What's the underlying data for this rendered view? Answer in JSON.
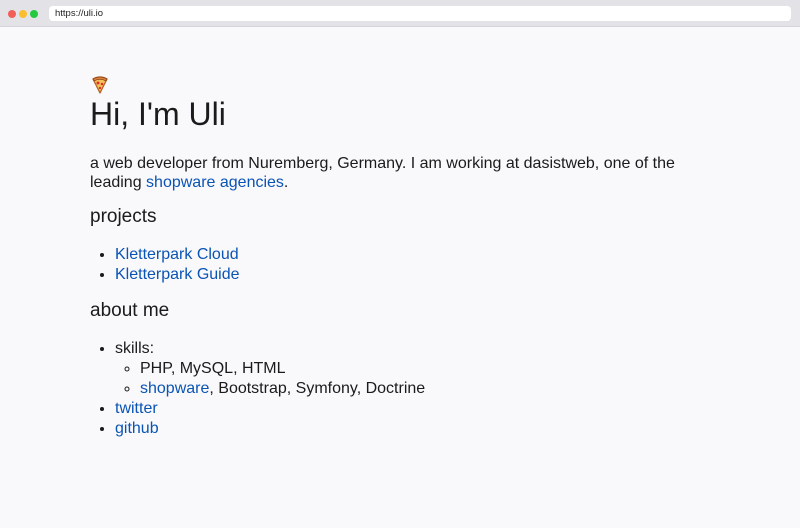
{
  "browser": {
    "url": "https://uli.io",
    "colors": {
      "close": "#f25f58",
      "minimize": "#fbbe2e",
      "maximize": "#25c93f"
    }
  },
  "page": {
    "emoji_icon": "pizza-icon",
    "title": "Hi, I'm Uli",
    "intro_text": "a web developer from Nuremberg, Germany. I am working at dasistweb, one of the leading ",
    "intro_link": "shopware agencies",
    "intro_end": ".",
    "link_color": "#0a54b4",
    "projects": {
      "heading": "projects",
      "items": [
        "Kletterpark Cloud",
        "Kletterpark Guide"
      ]
    },
    "about": {
      "heading": "about me",
      "skills_label": "skills:",
      "skills_line1": "PHP, MySQL, HTML",
      "skills_line2_link": "shopware",
      "skills_line2_rest": ", Bootstrap, Symfony, Doctrine",
      "twitter": "twitter",
      "github": "github"
    }
  }
}
